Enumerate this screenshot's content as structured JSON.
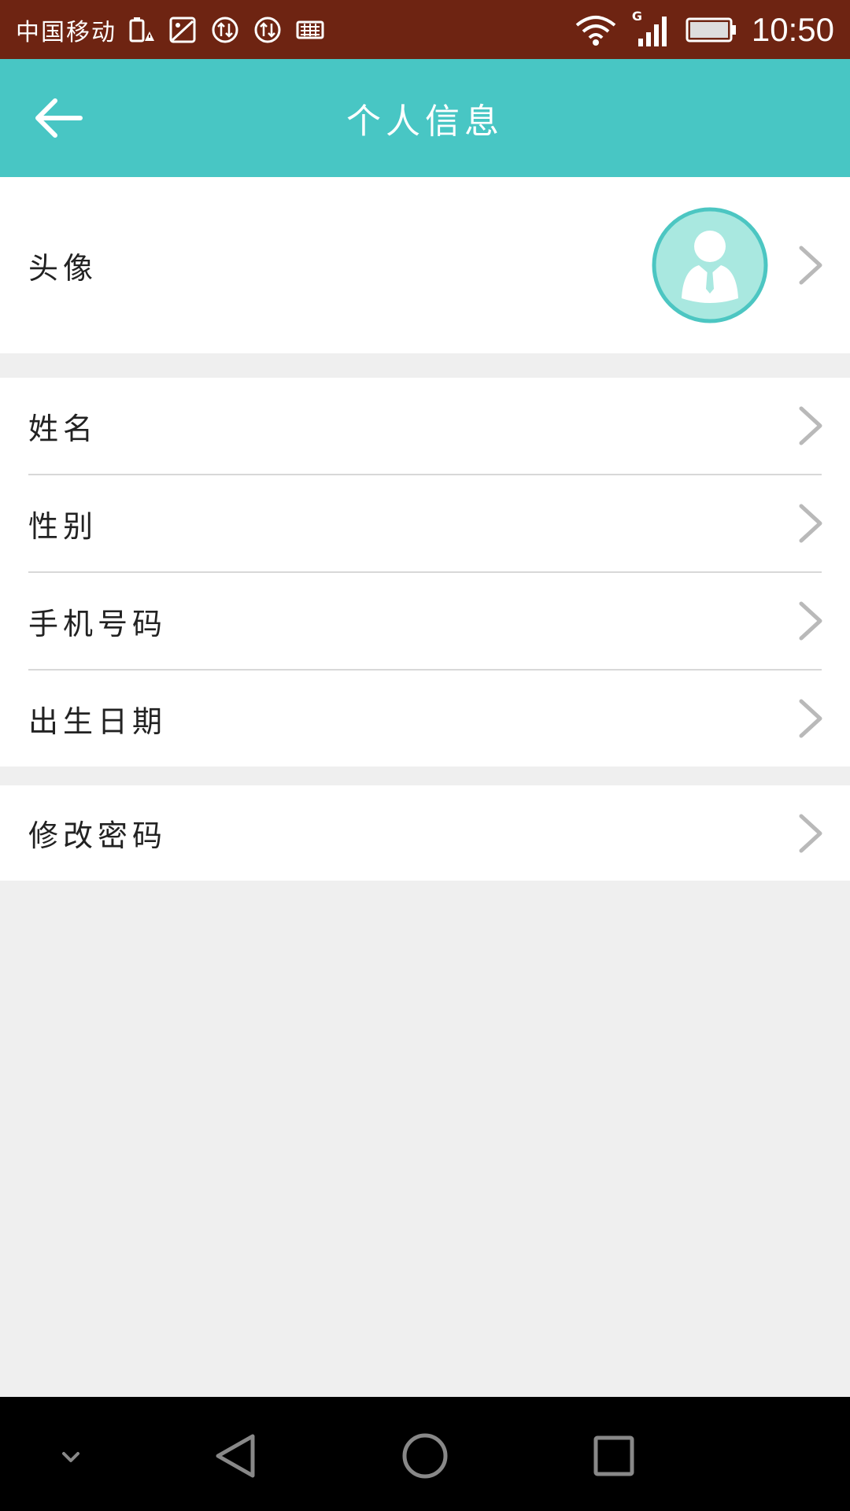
{
  "status_bar": {
    "carrier": "中国移动",
    "network_type": "G",
    "time": "10:50"
  },
  "app_bar": {
    "title": "个人信息",
    "back_icon": "arrow-left-icon"
  },
  "profile": {
    "avatar_label": "头像",
    "avatar_icon": "user-avatar-icon"
  },
  "info_items": [
    {
      "label": "姓名"
    },
    {
      "label": "性别"
    },
    {
      "label": "手机号码"
    },
    {
      "label": "出生日期"
    }
  ],
  "security": {
    "change_password_label": "修改密码"
  },
  "colors": {
    "status_bar": "#6e2412",
    "accent": "#48c6c4",
    "background": "#efefef"
  }
}
